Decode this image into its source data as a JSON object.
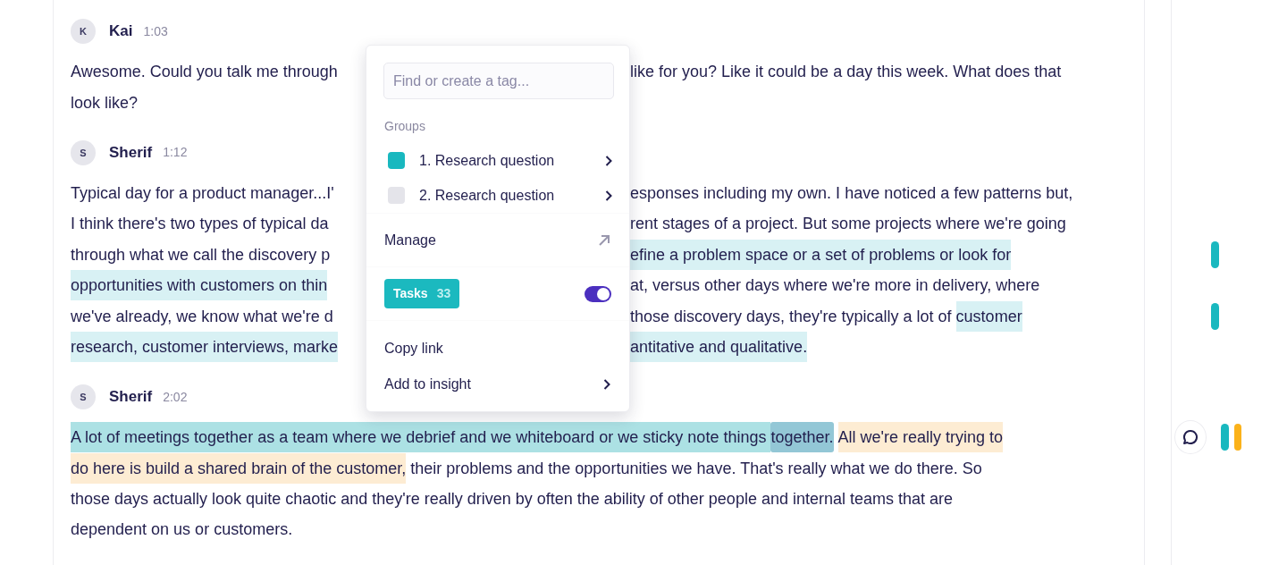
{
  "messages": [
    {
      "initial": "K",
      "speaker": "Kai",
      "time": "1:03",
      "lines": [
        {
          "left": [
            {
              "text": "Awesome. Could you talk me through",
              "kind": "plain"
            }
          ],
          "right": [
            {
              "text": "like for you? Like it could be a day this week. What does that",
              "kind": "plain"
            }
          ]
        },
        {
          "left": [
            {
              "text": "look like?",
              "kind": "plain"
            }
          ]
        }
      ]
    },
    {
      "initial": "S",
      "speaker": "Sherif",
      "time": "1:12",
      "lines": [
        {
          "left": [
            {
              "text": "Typical day for a product manager...I'",
              "kind": "plain"
            }
          ],
          "right": [
            {
              "text": "esponses including my own. I have noticed a few patterns but,",
              "kind": "plain"
            }
          ]
        },
        {
          "left": [
            {
              "text": "I think there's two types of typical da",
              "kind": "plain"
            }
          ],
          "right": [
            {
              "text": "rent stages of a project. But some projects where we're going",
              "kind": "plain"
            }
          ]
        },
        {
          "left": [
            {
              "text": "through what we call the discovery p",
              "kind": "plain"
            }
          ],
          "right": [
            {
              "text": "efine a problem space or a set of problems or look for",
              "kind": "light"
            }
          ],
          "markers": [
            {
              "kind": "bar",
              "color": "#19b8bf"
            }
          ]
        },
        {
          "left": [
            {
              "text": "opportunities with customers on thin",
              "kind": "light"
            }
          ],
          "right": [
            {
              "text": "at, versus other days where we're more in delivery, where",
              "kind": "plain"
            }
          ]
        },
        {
          "left": [
            {
              "text": "we've already, we know what we're d",
              "kind": "plain"
            }
          ],
          "right": [
            {
              "text": "those discovery days, they're typically a lot of ",
              "kind": "plain"
            },
            {
              "text": "customer",
              "kind": "light"
            }
          ],
          "markers": [
            {
              "kind": "bar",
              "color": "#19b8bf"
            }
          ]
        },
        {
          "left": [
            {
              "text": "research, customer interviews, marke",
              "kind": "light"
            }
          ],
          "right": [
            {
              "text": "antitative and qualitative.",
              "kind": "light"
            }
          ]
        }
      ]
    },
    {
      "initial": "S",
      "speaker": "Sherif",
      "time": "2:02",
      "lines": [
        {
          "left": [
            {
              "text": "A lot of meetings together as a team where we debrief and we whiteboard or we sticky note things ",
              "kind": "strong"
            },
            {
              "text": "together.",
              "kind": "selected"
            },
            {
              "text": "All we're really trying to",
              "kind": "orange"
            }
          ],
          "markers": [
            {
              "kind": "comment"
            },
            {
              "kind": "bar",
              "color": "#19b8bf"
            },
            {
              "kind": "bar",
              "color": "#fbb21a"
            }
          ]
        },
        {
          "left": [
            {
              "text": "do here is build a shared brain of the customer,",
              "kind": "orange"
            },
            {
              "text": " their problems and the opportunities we have. That's really what we do there. So",
              "kind": "plain"
            }
          ]
        },
        {
          "left": [
            {
              "text": "those days actually look quite chaotic and they're really driven by often the ability of other people and internal teams that are",
              "kind": "plain"
            }
          ]
        },
        {
          "left": [
            {
              "text": "dependent on us or customers.",
              "kind": "plain"
            }
          ]
        }
      ]
    }
  ],
  "tag_menu": {
    "search": {
      "placeholder": "Find or create a tag..."
    },
    "groups_label": "Groups",
    "groups": [
      {
        "label": "1. Research question",
        "color": "#19b8bf"
      },
      {
        "label": "2. Research question",
        "color": "#e4e4ea"
      }
    ],
    "manage": "Manage",
    "tag": {
      "label": "Tasks",
      "count": "33",
      "on": true
    },
    "actions": [
      {
        "label": "Copy link",
        "submenu": false
      },
      {
        "label": "Add to insight",
        "submenu": true
      }
    ]
  }
}
